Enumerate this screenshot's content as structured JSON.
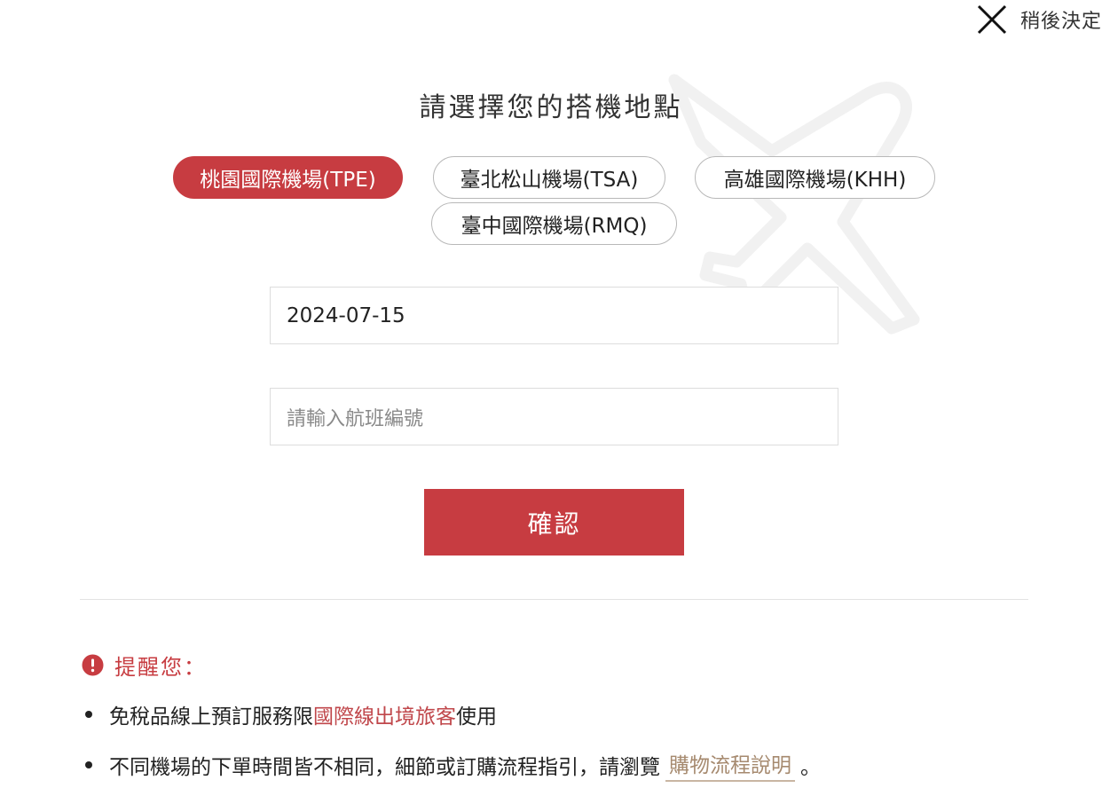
{
  "header": {
    "close_label": "稍後決定",
    "close_icon": "close-icon"
  },
  "dialog": {
    "title": "請選擇您的搭機地點",
    "watermark_icon": "airplane-icon"
  },
  "airports": {
    "items": [
      {
        "label": "桃園國際機場(TPE)",
        "selected": true
      },
      {
        "label": "臺北松山機場(TSA)",
        "selected": false
      },
      {
        "label": "高雄國際機場(KHH)",
        "selected": false
      },
      {
        "label": "臺中國際機場(RMQ)",
        "selected": false
      }
    ]
  },
  "form": {
    "date_value": "2024-07-15",
    "flight_placeholder": "請輸入航班編號",
    "confirm_label": "確認"
  },
  "reminder": {
    "icon": "exclamation-circle-icon",
    "title": "提醒您：",
    "notes": [
      {
        "before": "免稅品線上預訂服務限",
        "highlight": "國際線出境旅客",
        "after": "使用"
      },
      {
        "before": "不同機場的下單時間皆不相同，細節或訂購流程指引，請瀏覽",
        "link": "購物流程說明",
        "after": "。"
      }
    ]
  },
  "colors": {
    "accent": "#c73c41",
    "link": "#a68a6f",
    "border": "#dddddd"
  }
}
